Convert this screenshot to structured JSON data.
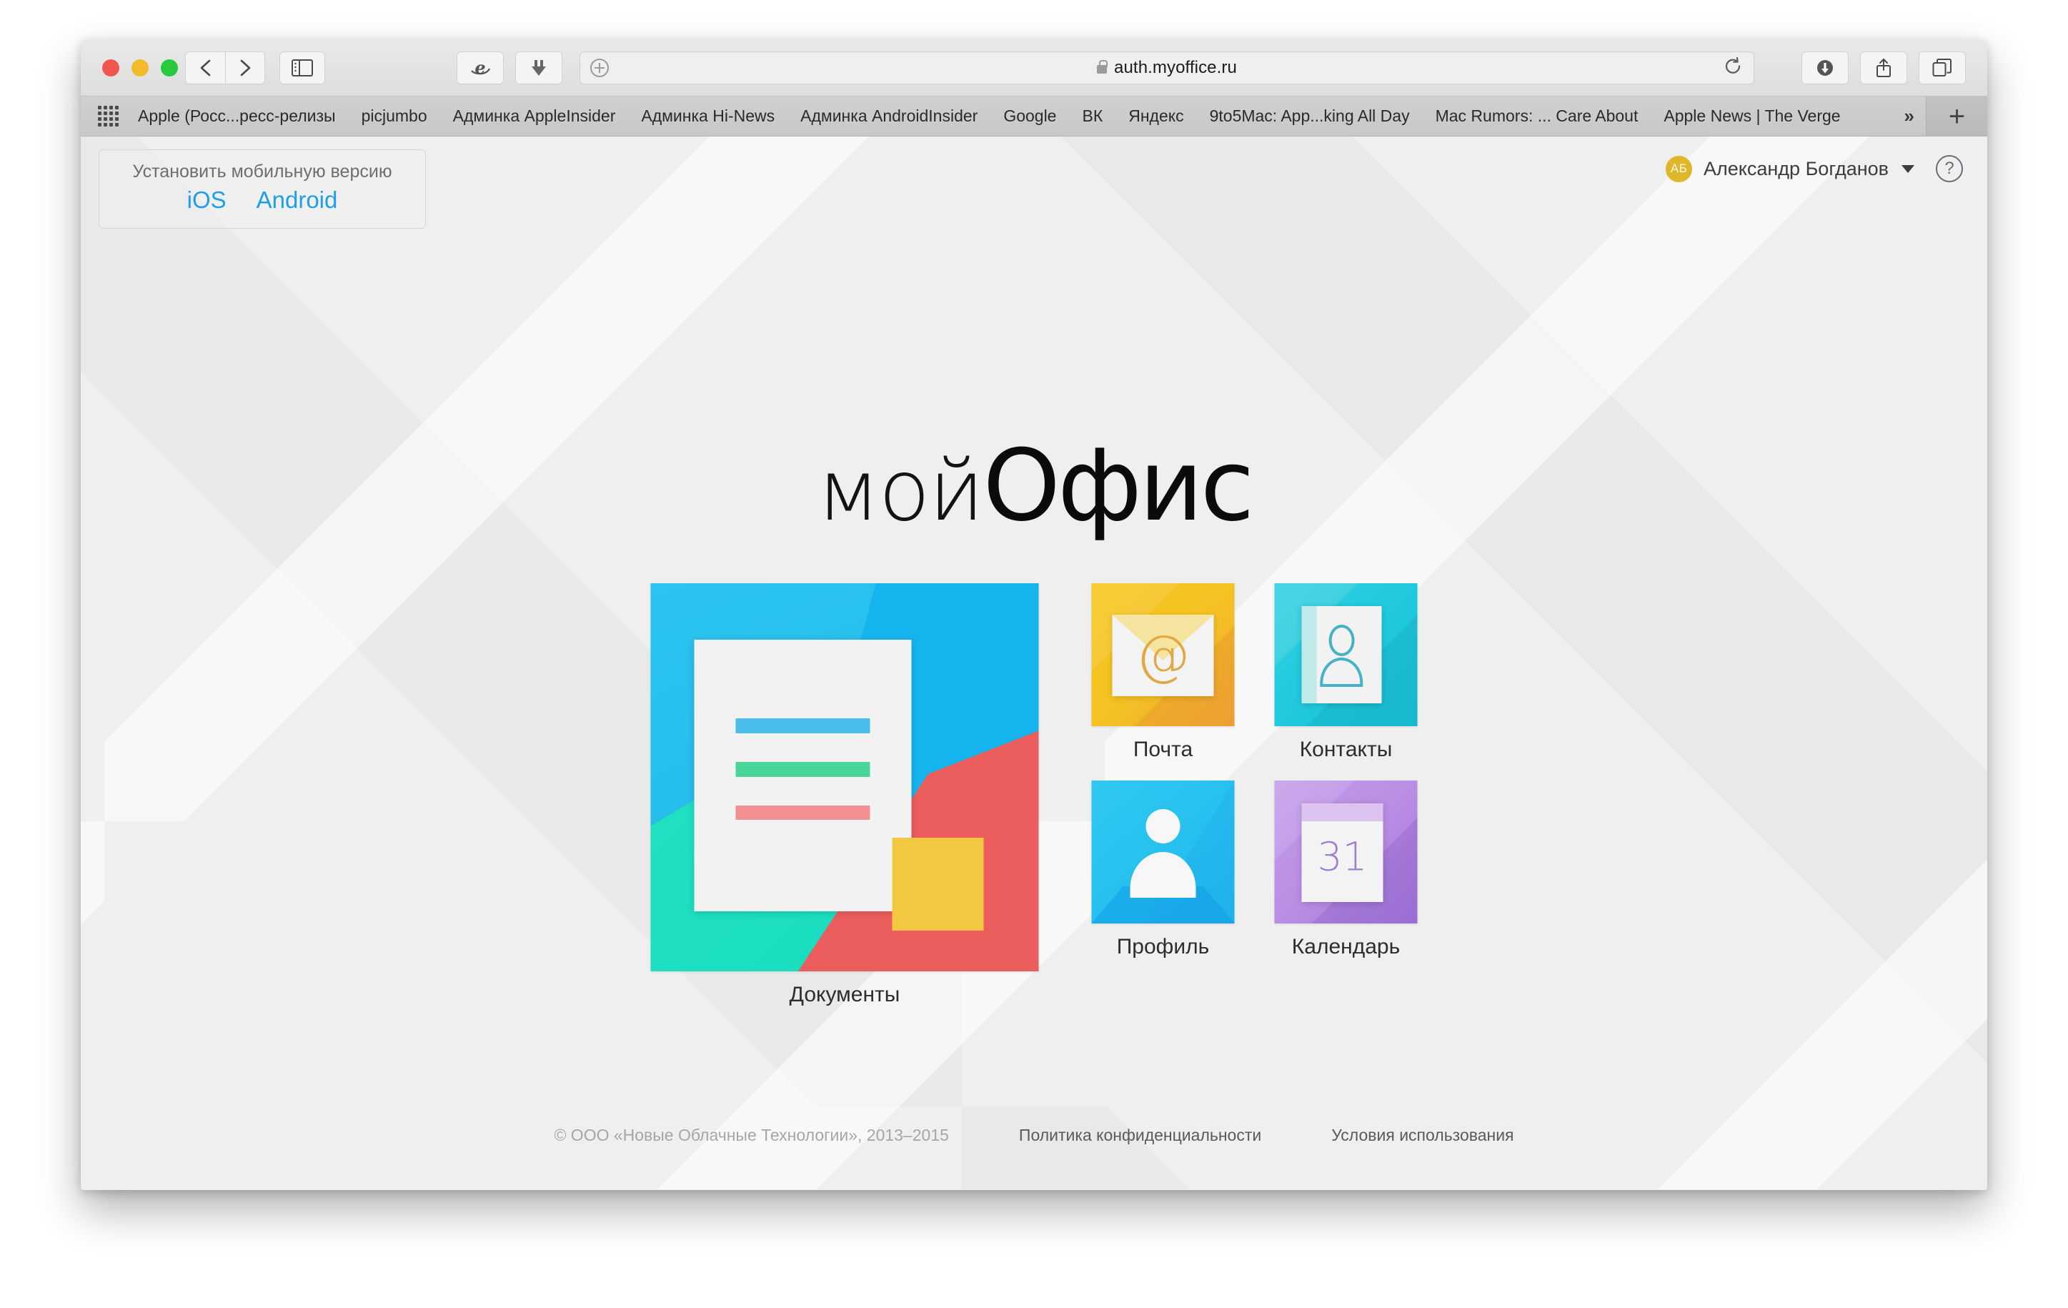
{
  "browser": {
    "url": "auth.myoffice.ru",
    "lock_icon": "lock-icon",
    "traffic_lights": [
      "close",
      "minimize",
      "zoom"
    ],
    "buttons": {
      "back": "back-icon",
      "forward": "forward-icon",
      "sidebar": "sidebar-icon",
      "ie_extension": "internet-explorer-icon",
      "downloader": "download-arrow-icon",
      "reload": "reload-icon",
      "downloads": "downloads-icon",
      "share": "share-icon",
      "tabs": "tab-overview-icon"
    },
    "bookmarks": [
      "Apple (Росс...ресс-релизы",
      "picjumbo",
      "Админка AppleInsider",
      "Админка Hi-News",
      "Админка AndroidInsider",
      "Google",
      "ВК",
      "Яндекс",
      "9to5Mac: App...king All Day",
      "Mac Rumors: ... Care About",
      "Apple News | The Verge"
    ],
    "bookmarks_overflow": "»",
    "bookmarks_add": "+"
  },
  "install_box": {
    "title": "Установить мобильную версию",
    "links": [
      "iOS",
      "Android"
    ],
    "link_color": "#1e9fe8"
  },
  "account": {
    "initials": "АБ",
    "name": "Александр Богданов",
    "avatar_color": "#e0b62a",
    "help_label": "?"
  },
  "logo": {
    "thin": "мой",
    "bold": "Офис"
  },
  "apps": {
    "documents": {
      "label": "Документы",
      "colors": [
        "#15b4ef",
        "#18dcc0",
        "#ec5d5d",
        "#f2c840"
      ]
    },
    "mail": {
      "label": "Почта",
      "glyph": "@",
      "color": "#f4c222"
    },
    "contacts": {
      "label": "Контакты",
      "color": "#1fc8dd"
    },
    "profile": {
      "label": "Профиль",
      "color": "#26c0ef"
    },
    "calendar": {
      "label": "Календарь",
      "day": "31",
      "color": "#b98ee4"
    }
  },
  "footer": {
    "copyright": "© ООО «Новые Облачные Технологии», 2013–2015",
    "privacy": "Политика конфиденциальности",
    "terms": "Условия использования"
  }
}
